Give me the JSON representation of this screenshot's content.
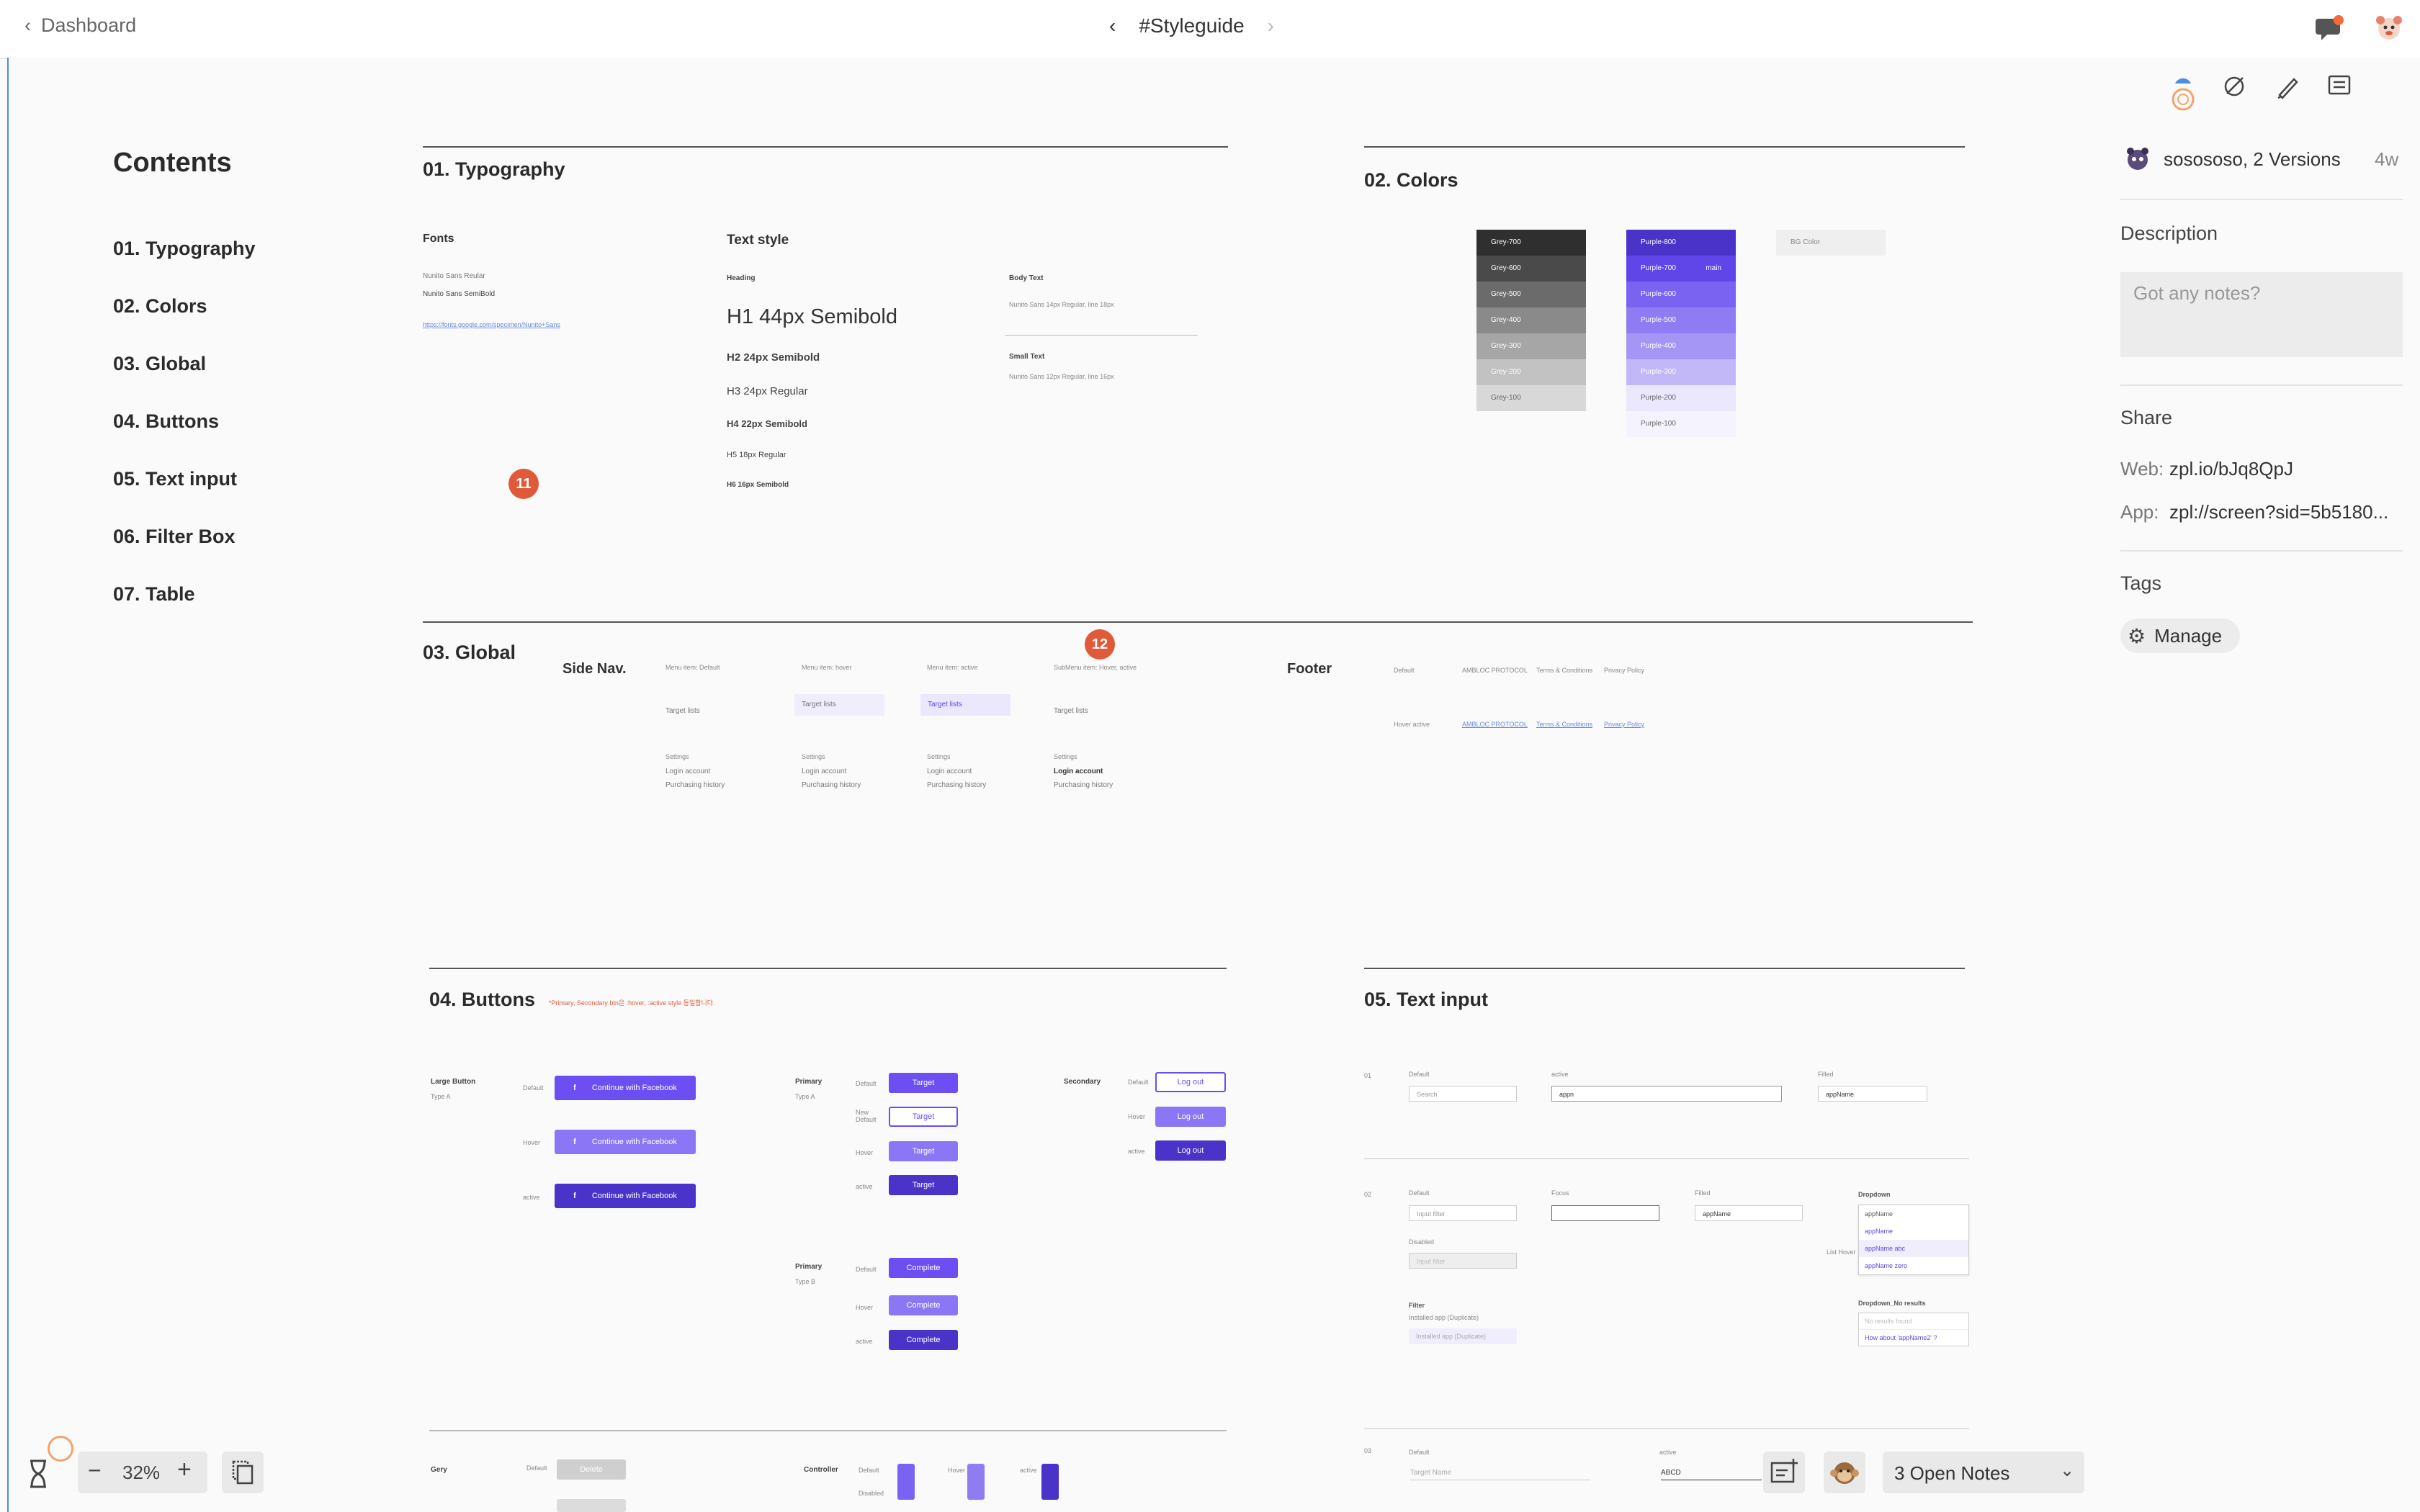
{
  "topbar": {
    "back_label": "Dashboard",
    "title": "#Styleguide"
  },
  "toc": {
    "title": "Contents",
    "items": [
      "01. Typography",
      "02. Colors",
      "03. Global",
      "04. Buttons",
      "05. Text input",
      "06. Filter Box",
      "07. Table"
    ]
  },
  "typography": {
    "title": "01. Typography",
    "fonts_label": "Fonts",
    "font1": "Nunito Sans Reular",
    "font2": "Nunito Sans SemiBold",
    "font_link": "https://fonts.google.com/specimen/Nunito+Sans",
    "textstyle_label": "Text style",
    "heading_label": "Heading",
    "h1": "H1  44px Semibold",
    "h2": "H2  24px Semibold",
    "h3": "H3  24px Regular",
    "h4": "H4  22px Semibold",
    "h5": "H5  18px Regular",
    "h6": "H6  16px Semibold",
    "body_label": "Body Text",
    "body_desc": "Nunito Sans 14px Regular, line 18px",
    "small_label": "Small Text",
    "small_desc": "Nunito Sans 12px Regular, line 16px"
  },
  "colors": {
    "title": "02. Colors",
    "greys": [
      {
        "name": "Grey-700",
        "hex": "#2f2f2f"
      },
      {
        "name": "Grey-600",
        "hex": "#4a4a4a"
      },
      {
        "name": "Grey-500",
        "hex": "#6b6b6b"
      },
      {
        "name": "Grey-400",
        "hex": "#8a8a8a"
      },
      {
        "name": "Grey-300",
        "hex": "#a6a6a6"
      },
      {
        "name": "Grey-200",
        "hex": "#c2c2c2"
      },
      {
        "name": "Grey-100",
        "hex": "#d8d8d8"
      }
    ],
    "purples": [
      {
        "name": "Purple-800",
        "hex": "#4a33c8"
      },
      {
        "name": "Purple-700",
        "hex": "#6046e8",
        "tag": "main"
      },
      {
        "name": "Purple-600",
        "hex": "#7a63f0"
      },
      {
        "name": "Purple-500",
        "hex": "#8f7cf3"
      },
      {
        "name": "Purple-400",
        "hex": "#a596f5"
      },
      {
        "name": "Purple-300",
        "hex": "#c2b8f8"
      },
      {
        "name": "Purple-200",
        "hex": "#ebe7fd"
      },
      {
        "name": "Purple-100",
        "hex": "#f5f3fe"
      }
    ],
    "bg_label": "BG Color"
  },
  "global": {
    "title": "03. Global",
    "sidenav_label": "Side Nav.",
    "states": [
      "Menu item: Default",
      "Menu item: hover",
      "Menu item: active",
      "SubMenu item: Hover, active"
    ],
    "item": "Target lists",
    "settings": "Settings",
    "login": "Login account",
    "history": "Purchasing history",
    "footer_label": "Footer",
    "footer_default": "Default",
    "footer_hover": "Hover active",
    "footer_links": [
      "AMBLOC PROTOCOL",
      "Terms & Conditions",
      "Privacy Policy"
    ]
  },
  "buttons": {
    "title": "04. Buttons",
    "note": "*Primary, Secondary btn은 :hover, :active style 동일합니다.",
    "large_label": "Large Button",
    "type_a": "Type A",
    "type_b": "Type B",
    "states": [
      "Default",
      "Hover",
      "active"
    ],
    "fb_label": "Continue with Facebook",
    "primary_label": "Primary",
    "secondary_label": "Secondary",
    "target": "Target",
    "complete": "Complete",
    "logout": "Log out",
    "gery_label": "Gery",
    "controller_label": "Controller",
    "new_default": "New Default",
    "disabled": "Disabled",
    "delete": "Delete"
  },
  "textinput": {
    "title": "05. Text input",
    "row1": "01",
    "row2": "02",
    "row3": "03",
    "default": "Default",
    "active": "active",
    "filled": "Filled",
    "focus": "Focus",
    "disabled": "Disabled",
    "search": "Search",
    "app_typed": "appn",
    "app_filled": "appName",
    "input_filter": "Input filter",
    "filter_label": "Filter",
    "installed": "Installed app (Duplicate)",
    "dropdown": "Dropdown",
    "dropdown_items": [
      "appName",
      "appName",
      "appName abc",
      "appName zero"
    ],
    "dropdown_no": "Dropdown_No results",
    "no_results": "No results found",
    "how_about": "How about 'appName2' ?",
    "list_hover": "List Hover",
    "target_name": "Target Name",
    "abcd": "ABCD"
  },
  "comments": {
    "badge1": "11",
    "badge2": "12"
  },
  "bottom": {
    "zoom": "32%",
    "open_notes": "3 Open Notes"
  },
  "sidebar": {
    "author": "sosososo, 2 Versions",
    "age": "4w",
    "description_title": "Description",
    "notes_placeholder": "Got any notes?",
    "share_title": "Share",
    "web_label": "Web:",
    "web_value": "zpl.io/bJq8QpJ",
    "app_label": "App:",
    "app_value": "zpl://screen?sid=5b5180...",
    "tags_title": "Tags",
    "manage_label": "Manage"
  }
}
